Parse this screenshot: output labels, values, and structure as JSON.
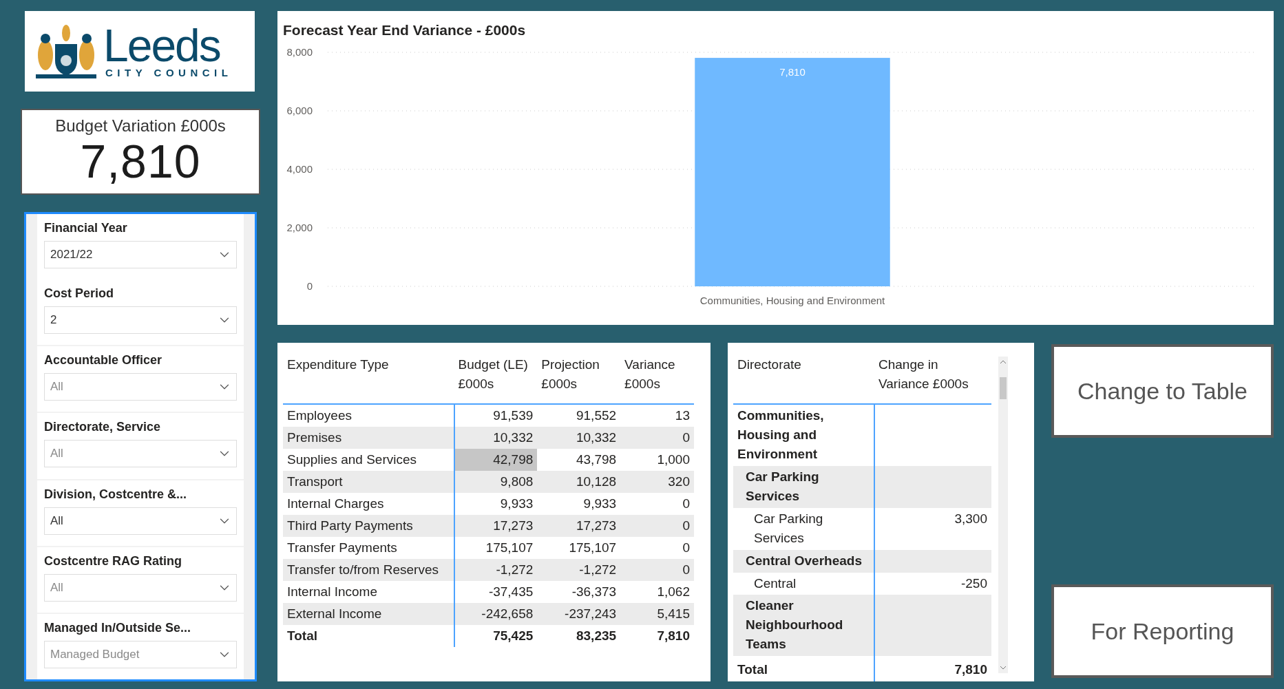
{
  "logo": {
    "name": "Leeds",
    "subtitle": "CITY COUNCIL"
  },
  "kpi": {
    "title": "Budget Variation £000s",
    "value": "7,810"
  },
  "filters": [
    {
      "label": "Financial Year",
      "value": "2021/22"
    },
    {
      "label": "Cost Period",
      "value": "2"
    },
    {
      "label": "Accountable Officer",
      "placeholder": "All"
    },
    {
      "label": "Directorate, Service",
      "placeholder": "All"
    },
    {
      "label": "Division, Costcentre &...",
      "value": "All"
    },
    {
      "label": "Costcentre RAG Rating",
      "placeholder": "All"
    },
    {
      "label": "Managed In/Outside Se...",
      "placeholder": "Managed Budget"
    }
  ],
  "chart": {
    "chart_data": {
      "type": "bar",
      "title": "Forecast Year End Variance - £000s",
      "categories": [
        "Communities, Housing and Environment"
      ],
      "series": [
        {
          "color": "#6fb9ff",
          "values": [
            7810
          ]
        }
      ],
      "grid": true,
      "ylim": [
        0,
        8000
      ],
      "yticks": [
        {
          "value": 0,
          "label": "0"
        },
        {
          "value": 2000,
          "label": "2,000"
        },
        {
          "value": 4000,
          "label": "4,000"
        },
        {
          "value": 6000,
          "label": "6,000"
        },
        {
          "value": 8000,
          "label": "8,000"
        }
      ],
      "value_labels": [
        "7,810"
      ]
    }
  },
  "expenditure": {
    "columns": [
      "Expenditure Type",
      "Budget (LE) £000s",
      "Projection £000s",
      "Variance £000s"
    ],
    "rows": [
      {
        "cells": [
          "Employees",
          "91,539",
          "91,552",
          "13"
        ],
        "budget_selected": false
      },
      {
        "cells": [
          "Premises",
          "10,332",
          "10,332",
          "0"
        ],
        "budget_selected": false
      },
      {
        "cells": [
          "Supplies and Services",
          "42,798",
          "43,798",
          "1,000"
        ],
        "budget_selected": true
      },
      {
        "cells": [
          "Transport",
          "9,808",
          "10,128",
          "320"
        ],
        "budget_selected": false
      },
      {
        "cells": [
          "Internal Charges",
          "9,933",
          "9,933",
          "0"
        ],
        "budget_selected": false
      },
      {
        "cells": [
          "Third Party Payments",
          "17,273",
          "17,273",
          "0"
        ],
        "budget_selected": false
      },
      {
        "cells": [
          "Transfer Payments",
          "175,107",
          "175,107",
          "0"
        ],
        "budget_selected": false
      },
      {
        "cells": [
          "Transfer to/from Reserves",
          "-1,272",
          "-1,272",
          "0"
        ],
        "budget_selected": false
      },
      {
        "cells": [
          "Internal Income",
          "-37,435",
          "-36,373",
          "1,062"
        ],
        "budget_selected": false
      },
      {
        "cells": [
          "External Income",
          "-242,658",
          "-237,243",
          "5,415"
        ],
        "budget_selected": false
      }
    ],
    "total": [
      "Total",
      "75,425",
      "83,235",
      "7,810"
    ]
  },
  "directorate": {
    "columns": [
      "Directorate",
      "Change in Variance £000s"
    ],
    "rows": [
      {
        "label": "Communities, Housing and Environment",
        "kind": "group",
        "children": [
          {
            "label": "Car Parking Services",
            "kind": "group",
            "children": [
              {
                "label": "Car Parking Services",
                "kind": "item",
                "value": "3,300"
              }
            ]
          },
          {
            "label": "Central Overheads",
            "kind": "group",
            "children": [
              {
                "label": "Central",
                "kind": "item",
                "value": "-250"
              }
            ]
          },
          {
            "label": "Cleaner Neighbourhood Teams",
            "kind": "group"
          }
        ]
      }
    ],
    "total": [
      "Total",
      "7,810"
    ]
  },
  "buttons": [
    "Change to Table",
    "For Reporting"
  ]
}
